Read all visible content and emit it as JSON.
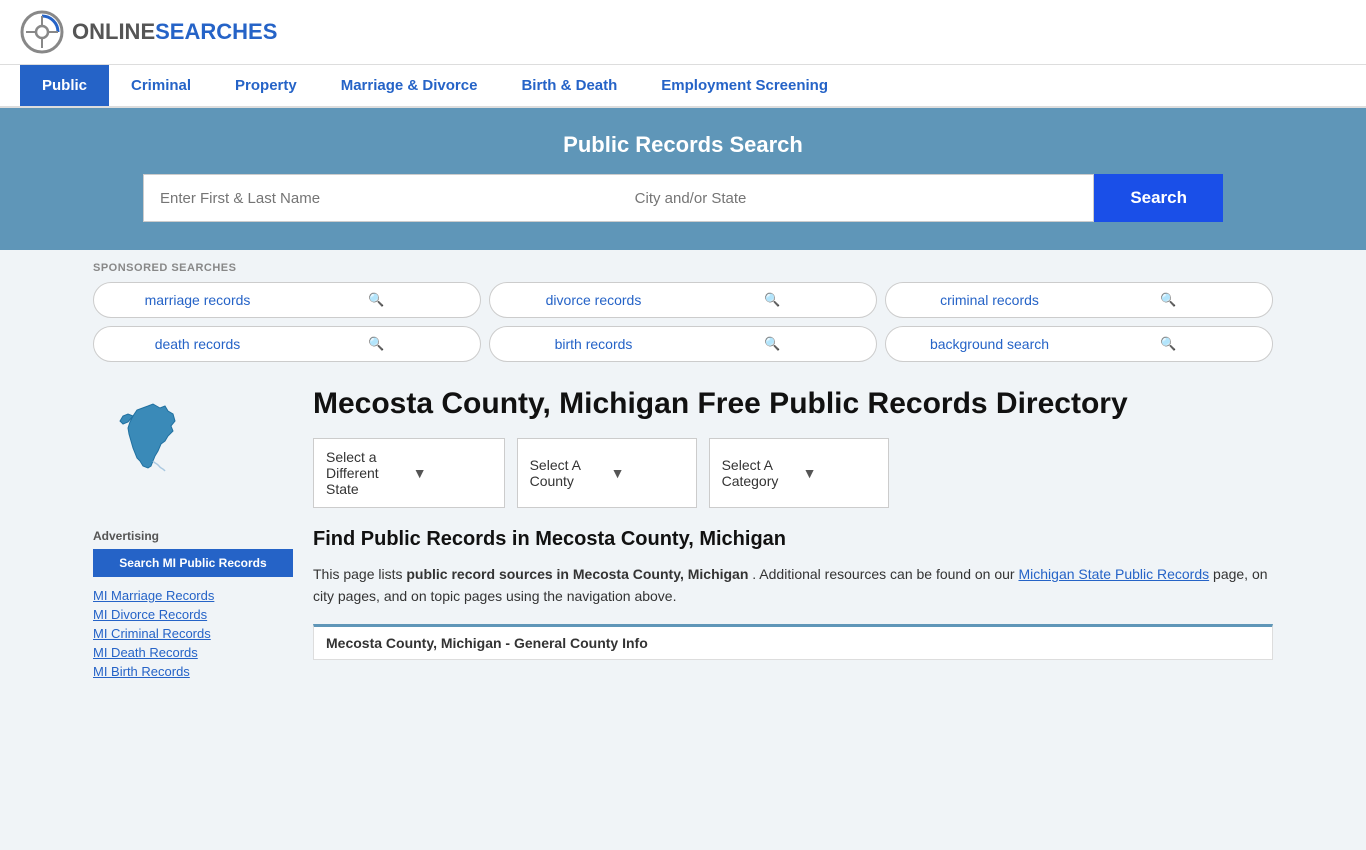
{
  "header": {
    "logo_online": "ONLINE",
    "logo_searches": "SEARCHES"
  },
  "nav": {
    "items": [
      {
        "label": "Public",
        "active": true
      },
      {
        "label": "Criminal",
        "active": false
      },
      {
        "label": "Property",
        "active": false
      },
      {
        "label": "Marriage & Divorce",
        "active": false
      },
      {
        "label": "Birth & Death",
        "active": false
      },
      {
        "label": "Employment Screening",
        "active": false
      }
    ]
  },
  "search_banner": {
    "title": "Public Records Search",
    "name_placeholder": "Enter First & Last Name",
    "city_placeholder": "City and/or State",
    "search_button": "Search"
  },
  "sponsored": {
    "label": "SPONSORED SEARCHES",
    "pills": [
      "marriage records",
      "divorce records",
      "criminal records",
      "death records",
      "birth records",
      "background search"
    ]
  },
  "sidebar": {
    "advertising_label": "Advertising",
    "ad_button": "Search MI Public Records",
    "links": [
      "MI Marriage Records",
      "MI Divorce Records",
      "MI Criminal Records",
      "MI Death Records",
      "MI Birth Records"
    ]
  },
  "main": {
    "page_title": "Mecosta County, Michigan Free Public Records Directory",
    "dropdown_state": "Select a Different State",
    "dropdown_county": "Select A County",
    "dropdown_category": "Select A Category",
    "find_records_title": "Find Public Records in Mecosta County, Michigan",
    "description": "This page lists ",
    "description_bold": "public record sources in Mecosta County, Michigan",
    "description_after": ". Additional resources can be found on our ",
    "michigan_link": "Michigan State Public Records",
    "description_end": " page, on city pages, and on topic pages using the navigation above.",
    "general_info_bar": "Mecosta County, Michigan - General County Info"
  }
}
